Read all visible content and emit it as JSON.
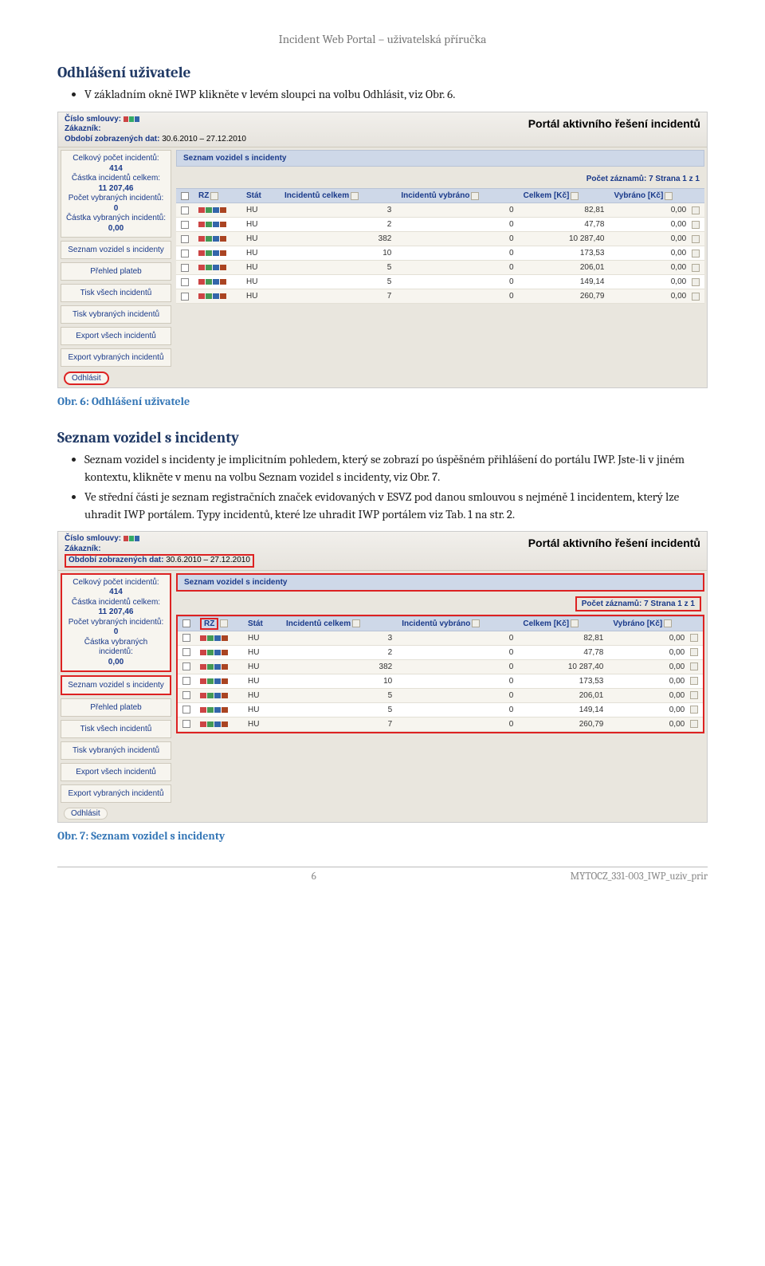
{
  "doc": {
    "header": "Incident Web Portal – uživatelská příručka",
    "footer_page": "6",
    "footer_code": "MYTOCZ_331-003_IWP_uziv_prir"
  },
  "sec1": {
    "title": "Odhlášení uživatele",
    "bullet": "V základním okně IWP klikněte v levém sloupci na volbu Odhlásit, viz Obr. 6.",
    "caption": "Obr. 6: Odhlášení uživatele"
  },
  "sec2": {
    "title": "Seznam vozidel s incidenty",
    "bullet1": "Seznam vozidel s incidenty je implicitním pohledem, který se zobrazí po úspěšném přihlášení do portálu IWP. Jste-li v jiném kontextu, klikněte v menu na volbu Seznam vozidel s incidenty, viz Obr. 7.",
    "bullet2": "Ve střední části je seznam registračních značek evidovaných v ESVZ pod danou smlouvou s nejméně 1 incidentem, který lze uhradit IWP portálem. Typy incidentů, které lze uhradit IWP portálem viz Tab. 1 na str. 2.",
    "caption": "Obr. 7: Seznam vozidel s incidenty"
  },
  "shot": {
    "top": {
      "l1": "Číslo smlouvy:",
      "l2": "Zákazník:",
      "l3a": "Období zobrazených dat:",
      "l3b": "30.6.2010 – 27.12.2010",
      "right": "Portál aktivního řešení incidentů"
    },
    "side": {
      "box_l1": "Celkový počet incidentů:",
      "box_v1": "414",
      "box_l2": "Částka incidentů celkem:",
      "box_v2": "11 207,46",
      "box_l3": "Počet vybraných incidentů:",
      "box_v3": "0",
      "box_l4": "Částka vybraných incidentů:",
      "box_v4": "0,00",
      "btn1": "Seznam vozidel s incidenty",
      "btn2": "Přehled plateb",
      "btn3": "Tisk všech incidentů",
      "btn4": "Tisk vybraných incidentů",
      "btn5": "Export všech incidentů",
      "btn6": "Export vybraných incidentů",
      "btn7": "Odhlásit"
    },
    "panel_title": "Seznam vozidel s incidenty",
    "countbar": "Počet záznamů: 7 Strana 1 z 1",
    "cols": {
      "rz": "RZ",
      "stat": "Stát",
      "c1": "Incidentů celkem",
      "c2": "Incidentů vybráno",
      "c3": "Celkem [Kč]",
      "c4": "Vybráno [Kč]"
    },
    "rows": [
      {
        "stat": "HU",
        "c1": "3",
        "c2": "0",
        "c3": "82,81",
        "c4": "0,00"
      },
      {
        "stat": "HU",
        "c1": "2",
        "c2": "0",
        "c3": "47,78",
        "c4": "0,00"
      },
      {
        "stat": "HU",
        "c1": "382",
        "c2": "0",
        "c3": "10 287,40",
        "c4": "0,00"
      },
      {
        "stat": "HU",
        "c1": "10",
        "c2": "0",
        "c3": "173,53",
        "c4": "0,00"
      },
      {
        "stat": "HU",
        "c1": "5",
        "c2": "0",
        "c3": "206,01",
        "c4": "0,00"
      },
      {
        "stat": "HU",
        "c1": "5",
        "c2": "0",
        "c3": "149,14",
        "c4": "0,00"
      },
      {
        "stat": "HU",
        "c1": "7",
        "c2": "0",
        "c3": "260,79",
        "c4": "0,00"
      }
    ]
  }
}
